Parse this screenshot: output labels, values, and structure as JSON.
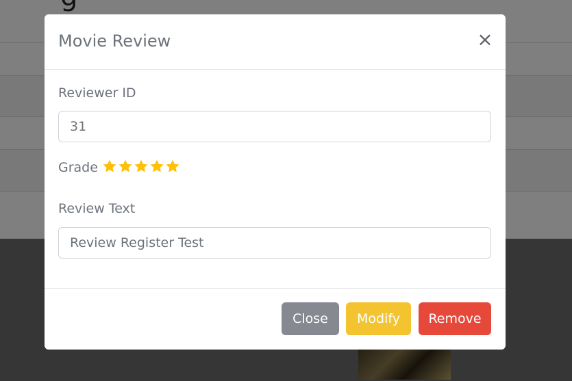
{
  "modal": {
    "title": "Movie Review",
    "close_icon": "×",
    "reviewer": {
      "label": "Reviewer ID",
      "value": "31"
    },
    "grade": {
      "label": "Grade",
      "stars": 5,
      "max": 5,
      "star_color": "#ffc107"
    },
    "review_text": {
      "label": "Review Text",
      "value": "Review Register Test"
    },
    "buttons": {
      "close": "Close",
      "modify": "Modify",
      "remove": "Remove"
    }
  },
  "background": {
    "title_fragment": "g"
  },
  "colors": {
    "overlay": "rgba(0,0,0,0.5)",
    "close_button": "#868892",
    "modify_button": "#f4c430",
    "remove_button": "#e6493a",
    "text_muted": "#6c727a"
  }
}
